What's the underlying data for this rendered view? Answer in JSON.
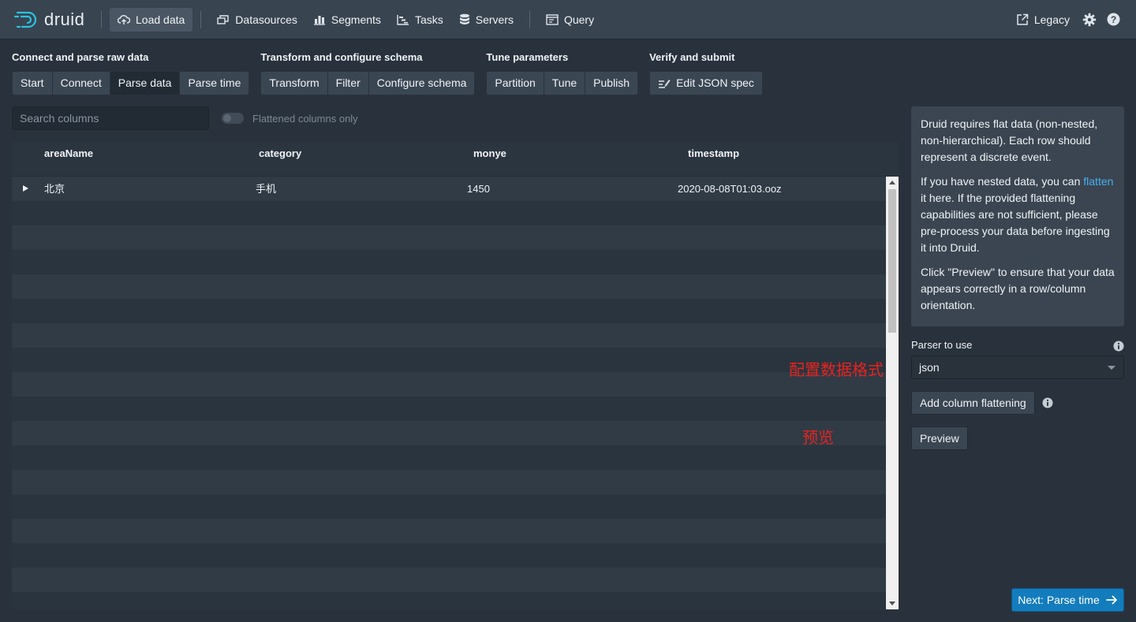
{
  "nav": {
    "logo_text": "druid",
    "items": [
      {
        "label": "Load data",
        "icon": "cloud-upload-icon",
        "active": true
      },
      {
        "label": "Datasources",
        "icon": "multi-select-icon"
      },
      {
        "label": "Segments",
        "icon": "stacked-chart-icon"
      },
      {
        "label": "Tasks",
        "icon": "gantt-chart-icon"
      },
      {
        "label": "Servers",
        "icon": "database-icon"
      },
      {
        "label": "Query",
        "icon": "application-icon"
      }
    ],
    "legacy_label": "Legacy"
  },
  "steps": [
    {
      "title": "Connect and parse raw data",
      "buttons": [
        "Start",
        "Connect",
        "Parse data",
        "Parse time"
      ],
      "active": "Parse data"
    },
    {
      "title": "Transform and configure schema",
      "buttons": [
        "Transform",
        "Filter",
        "Configure schema"
      ]
    },
    {
      "title": "Tune parameters",
      "buttons": [
        "Partition",
        "Tune",
        "Publish"
      ]
    },
    {
      "title": "Verify and submit",
      "buttons": [
        "Edit JSON spec"
      ]
    }
  ],
  "search": {
    "placeholder": "Search columns"
  },
  "flatten_toggle": {
    "label": "Flattened columns only",
    "on": false
  },
  "table": {
    "columns": [
      "areaName",
      "category",
      "monye",
      "timestamp"
    ],
    "rows": [
      [
        "北京",
        "手机",
        "1450",
        "2020-08-08T01:03.ooz"
      ]
    ]
  },
  "annotations": {
    "parser_note": "配置数据格式",
    "preview_note": "预览"
  },
  "info": {
    "p1": "Druid requires flat data (non-nested, non-hierarchical). Each row should represent a discrete event.",
    "p2_before": "If you have nested data, you can ",
    "p2_link": "flatten",
    "p2_after": " it here. If the provided flattening capabilities are not sufficient, please pre-process your data before ingesting it into Druid.",
    "p3": "Click \"Preview\" to ensure that your data appears correctly in a row/column orientation."
  },
  "parser": {
    "label": "Parser to use",
    "value": "json"
  },
  "buttons": {
    "add_flattening": "Add column flattening",
    "preview": "Preview",
    "next": "Next: Parse time"
  },
  "colors": {
    "accent": "#137cbd",
    "link": "#48aff0",
    "annotation": "#e8231f",
    "background": "#29323c"
  }
}
